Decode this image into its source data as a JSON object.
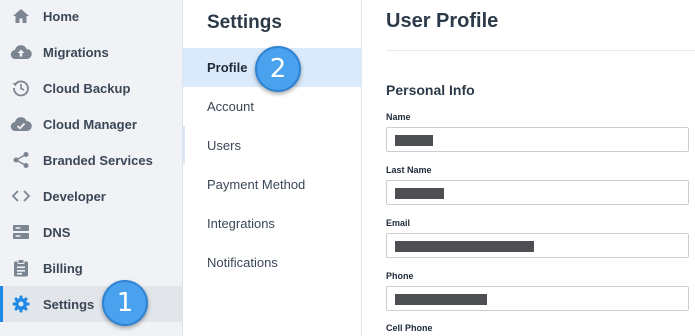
{
  "nav": {
    "items": [
      {
        "label": "Home",
        "icon": "home-icon"
      },
      {
        "label": "Migrations",
        "icon": "cloud-upload-icon"
      },
      {
        "label": "Cloud Backup",
        "icon": "history-icon"
      },
      {
        "label": "Cloud Manager",
        "icon": "cloud-check-icon"
      },
      {
        "label": "Branded Services",
        "icon": "share-icon"
      },
      {
        "label": "Developer",
        "icon": "code-icon"
      },
      {
        "label": "DNS",
        "icon": "server-icon"
      },
      {
        "label": "Billing",
        "icon": "clipboard-icon"
      },
      {
        "label": "Settings",
        "icon": "gear-icon"
      }
    ],
    "active": "Settings"
  },
  "settings_menu": {
    "title": "Settings",
    "items": [
      "Profile",
      "Account",
      "Users",
      "Payment Method",
      "Integrations",
      "Notifications"
    ],
    "active": "Profile"
  },
  "badges": {
    "one": "1",
    "two": "2"
  },
  "profile": {
    "title": "User Profile",
    "section": "Personal Info",
    "fields": [
      {
        "label": "Name"
      },
      {
        "label": "Last Name"
      },
      {
        "label": "Email"
      },
      {
        "label": "Phone"
      },
      {
        "label": "Cell Phone"
      }
    ]
  },
  "colors": {
    "accent": "#1f8ae6",
    "badge": "#4aa1ee",
    "active_menu_bg": "#daeafa",
    "nav_bg": "#f0f2f5",
    "icon": "#7c8592"
  }
}
